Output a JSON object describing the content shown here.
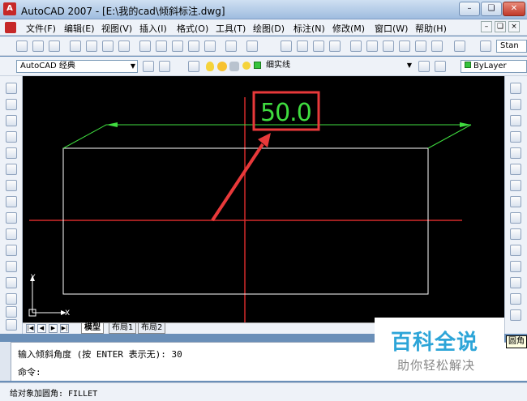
{
  "window": {
    "title": "AutoCAD 2007 - [E:\\我的cad\\倾斜标注.dwg]",
    "app_icon": "A"
  },
  "menu": {
    "items": [
      {
        "label": "文件(F)"
      },
      {
        "label": "编辑(E)"
      },
      {
        "label": "视图(V)"
      },
      {
        "label": "插入(I)"
      },
      {
        "label": "格式(O)"
      },
      {
        "label": "工具(T)"
      },
      {
        "label": "绘图(D)"
      },
      {
        "label": "标注(N)"
      },
      {
        "label": "修改(M)"
      },
      {
        "label": "窗口(W)"
      },
      {
        "label": "帮助(H)"
      }
    ]
  },
  "toolbar": {
    "text_style_combo": "Stan",
    "workspace_combo": "AutoCAD 经典",
    "layer_combo": "细实线",
    "color_combo": "ByLayer"
  },
  "drawing": {
    "dimension_value": "50.0",
    "ucs_x": "X",
    "ucs_y": "Y",
    "colors": {
      "background": "#000000",
      "rectangle": "#ffffff",
      "dimension": "#3fdc3f",
      "centerline": "#d42b2b",
      "annotation": "#e8393a"
    }
  },
  "layout_tabs": [
    "模型",
    "布局1",
    "布局2"
  ],
  "command": {
    "history_line": "输入倾斜角度 (按 ENTER 表示无): 30",
    "prompt": "命令:"
  },
  "status": {
    "text": "给对象加圆角:  FILLET"
  },
  "tooltip": "圆角",
  "watermark": {
    "title": "百科全说",
    "subtitle": "助你轻松解决"
  }
}
